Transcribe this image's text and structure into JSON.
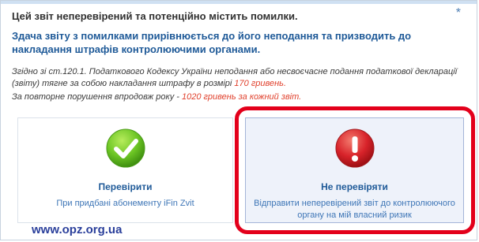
{
  "dialog": {
    "title": "Цей звіт неперевірений та потенційно містить помилки.",
    "warning": "Здача звіту з помилками прирівнюється до його неподання та призводить до накладання штрафів контролюючими органами.",
    "legal_text": "Згідно зі ст.120.1. Податкового Кодексу України неподання або несвоєчасне подання податкової декларації (звіту) тягне за собою накладання штрафу в розмірі ",
    "legal_amount": "170 гривень.",
    "repeat_text": "За повторне порушення впродовж року - ",
    "repeat_amount": "1020 гривень за кожний звіт."
  },
  "close_icon": "*",
  "choices": {
    "check": {
      "title": "Перевірити",
      "description": "При придбані абонементу iFin Zvit",
      "icon": "green-check-icon",
      "color": "#6cc524"
    },
    "skip": {
      "title": "Не перевіряти",
      "description": "Відправити неперевірений звіт до контролюючого органу на мій власний ризик",
      "icon": "red-exclamation-icon",
      "color": "#d8232a"
    }
  },
  "watermark": "www.opz.org.ua",
  "highlight_color": "#e3001b"
}
